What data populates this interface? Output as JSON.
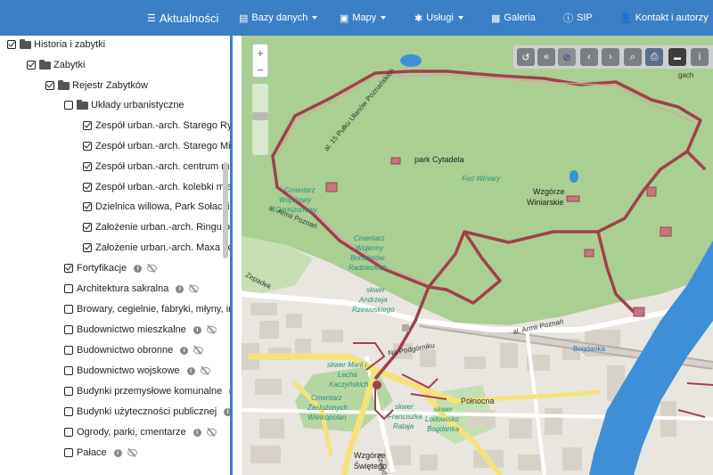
{
  "navbar": {
    "items": [
      {
        "label": "Aktualności",
        "icon": "list-icon"
      },
      {
        "label": "Bazy danych",
        "icon": "database-icon",
        "dropdown": true
      },
      {
        "label": "Mapy",
        "icon": "image-icon",
        "dropdown": true
      },
      {
        "label": "Usługi",
        "icon": "gear-icon",
        "dropdown": true
      },
      {
        "label": "Galeria",
        "icon": "grid-icon"
      },
      {
        "label": "SIP",
        "icon": "info-icon"
      },
      {
        "label": "Kontakt i autorzy",
        "icon": "user-icon",
        "dropdown": true
      }
    ]
  },
  "tree": {
    "items": [
      {
        "label": "Historia i zabytki",
        "checked": true,
        "folder": true
      },
      {
        "label": "Zabytki",
        "checked": true,
        "folder": true
      },
      {
        "label": "Rejestr Zabytków",
        "checked": true,
        "folder": true
      },
      {
        "label": "Układy urbanistyczne",
        "checked": false,
        "folder": true
      },
      {
        "label": "Zespół urban.-arch. Starego Ry",
        "checked": true
      },
      {
        "label": "Zespół urban.-arch. Starego Mi",
        "checked": true
      },
      {
        "label": "Zespół urban.-arch. centrum mi",
        "checked": true
      },
      {
        "label": "Zespół urban.-arch. kolebki mia",
        "checked": true
      },
      {
        "label": "Dzielnica willowa, Park Sołacki",
        "checked": true
      },
      {
        "label": "Założenie urban.-arch. Ringu p",
        "checked": true
      },
      {
        "label": "Założenie urban.-arch. Maxa Jo",
        "checked": true
      },
      {
        "label": "Fortyfikacje",
        "checked": true
      },
      {
        "label": "Architektura sakralna",
        "checked": false
      },
      {
        "label": "Browary, cegielnie, fabryki, młyny, ir",
        "checked": false
      },
      {
        "label": "Budownictwo mieszkalne",
        "checked": false
      },
      {
        "label": "Budownictwo obronne",
        "checked": false
      },
      {
        "label": "Budownictwo wojskowe",
        "checked": false
      },
      {
        "label": "Budynki przemysłowe komunalne",
        "checked": false
      },
      {
        "label": "Budynki użyteczności publicznej",
        "checked": false
      },
      {
        "label": "Ogrody, parki, cmentarze",
        "checked": false
      },
      {
        "label": "Pałace",
        "checked": false
      }
    ]
  },
  "map": {
    "zoom_in": "+",
    "zoom_out": "−",
    "labels": {
      "street_1": "al. 15 Pułku Ułanów Poznańskich",
      "park": "park Cytadela",
      "fort": "Fort Winiary",
      "hill_1": "Wzgórze",
      "hill_2": "Winiarskie",
      "cem1_1": "Cmentarz",
      "cem1_2": "Wojskowy",
      "cem1_3": "Garnizonowy",
      "street_armii_1": "al. Armii Poznań",
      "cem2_1": "Cmentarz",
      "cem2_2": "Wojenny",
      "cem2_3": "Bohaterów",
      "cem2_4": "Radzieckich",
      "sq1_1": "skwer",
      "sq1_2": "Andrzeja",
      "sq1_3": "Rzewuskiego",
      "street_armii_2": "al. Armii Poznań",
      "street_podgorniku": "Na Podgórniku",
      "sq2_1": "skwer Marii i",
      "sq2_2": "Lecha",
      "sq2_3": "Kaczyńskich",
      "north": "Północna",
      "cem3_1": "Cmentarz",
      "cem3_2": "Zasłużonych",
      "cem3_3": "Wielkopolan",
      "sq3_1": "skwer",
      "sq3_2": "Franciszka",
      "sq3_3": "Rataja",
      "sq4_1": "skwer",
      "sq4_2": "Lodowisko",
      "sq4_3": "Bogdanka",
      "bogdanka": "Bogdanka",
      "hill3_1": "Wzgórze",
      "hill3_2": "Świętego",
      "street_top": "gach",
      "street_left": "Zepadek",
      "street_bottom": "Szwedzka"
    }
  },
  "toolbar": {
    "buttons": [
      "share-icon",
      "double-chevron-left-icon",
      "eye-slash-icon",
      "chevron-left-icon",
      "chevron-right-icon",
      "search-icon",
      "print-icon",
      "ruler-icon",
      "info-icon"
    ]
  },
  "colors": {
    "navbar": "#3b80c6",
    "park": "#aacf93",
    "fortification": "#a0414c",
    "river": "#3f8fd8",
    "road_yellow": "#f6e27d"
  }
}
